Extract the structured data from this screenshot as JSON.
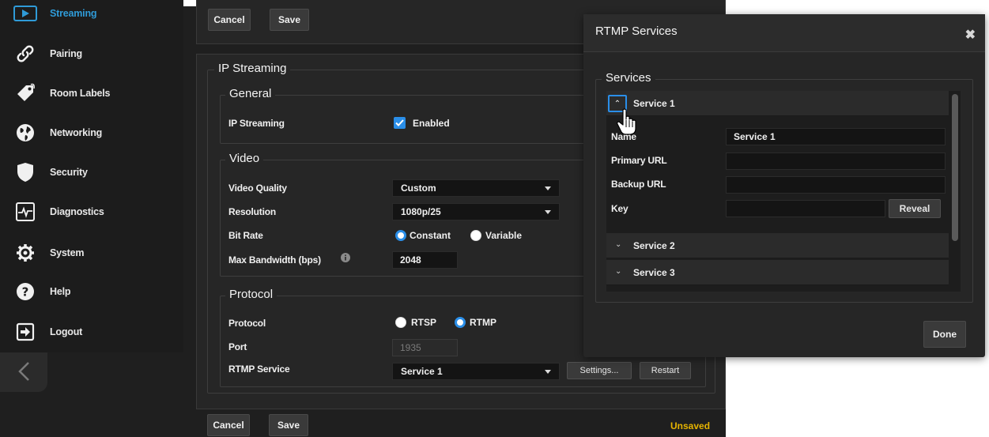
{
  "sidebar": {
    "items": [
      {
        "label": "Streaming",
        "icon": "play-icon",
        "active": true
      },
      {
        "label": "Pairing",
        "icon": "link-icon"
      },
      {
        "label": "Room Labels",
        "icon": "tag-icon"
      },
      {
        "label": "Networking",
        "icon": "globe-icon"
      },
      {
        "label": "Security",
        "icon": "shield-icon"
      },
      {
        "label": "Diagnostics",
        "icon": "pulse-icon"
      },
      {
        "label": "System",
        "icon": "gear-icon"
      },
      {
        "label": "Help",
        "icon": "help-icon"
      },
      {
        "label": "Logout",
        "icon": "logout-icon"
      }
    ],
    "collapse_icon": "chevron-left-icon"
  },
  "toolbar_top": {
    "cancel": "Cancel",
    "save": "Save"
  },
  "ip_streaming": {
    "title": "IP Streaming",
    "general": {
      "title": "General",
      "ip_streaming_label": "IP Streaming",
      "enabled_label": "Enabled",
      "enabled": true
    },
    "video": {
      "title": "Video",
      "quality_label": "Video Quality",
      "quality_value": "Custom",
      "resolution_label": "Resolution",
      "resolution_value": "1080p/25",
      "bitrate_label": "Bit Rate",
      "bitrate_options": [
        "Constant",
        "Variable"
      ],
      "bitrate_selected": "Constant",
      "bandwidth_label": "Max Bandwidth (bps)",
      "bandwidth_value": "2048"
    },
    "protocol": {
      "title": "Protocol",
      "protocol_label": "Protocol",
      "protocol_options": [
        "RTSP",
        "RTMP"
      ],
      "protocol_selected": "RTMP",
      "port_label": "Port",
      "port_placeholder": "1935",
      "rtmp_service_label": "RTMP Service",
      "rtmp_service_value": "Service 1",
      "settings_button": "Settings...",
      "restart_button": "Restart"
    }
  },
  "toolbar_bottom": {
    "cancel": "Cancel",
    "save": "Save",
    "status": "Unsaved"
  },
  "modal": {
    "title": "RTMP Services",
    "section_title": "Services",
    "services": [
      {
        "title": "Service 1",
        "expanded": true,
        "fields": {
          "name_label": "Name",
          "name_value": "Service 1",
          "primary_url_label": "Primary URL",
          "primary_url_value": "",
          "backup_url_label": "Backup URL",
          "backup_url_value": "",
          "key_label": "Key",
          "key_value": "",
          "reveal_button": "Reveal"
        }
      },
      {
        "title": "Service 2",
        "expanded": false
      },
      {
        "title": "Service 3",
        "expanded": false
      }
    ],
    "done_button": "Done"
  },
  "colors": {
    "accent": "#2a8ee8",
    "active_nav": "#2f9bd8",
    "unsaved": "#e6b400",
    "background": "#1f1f1f"
  }
}
